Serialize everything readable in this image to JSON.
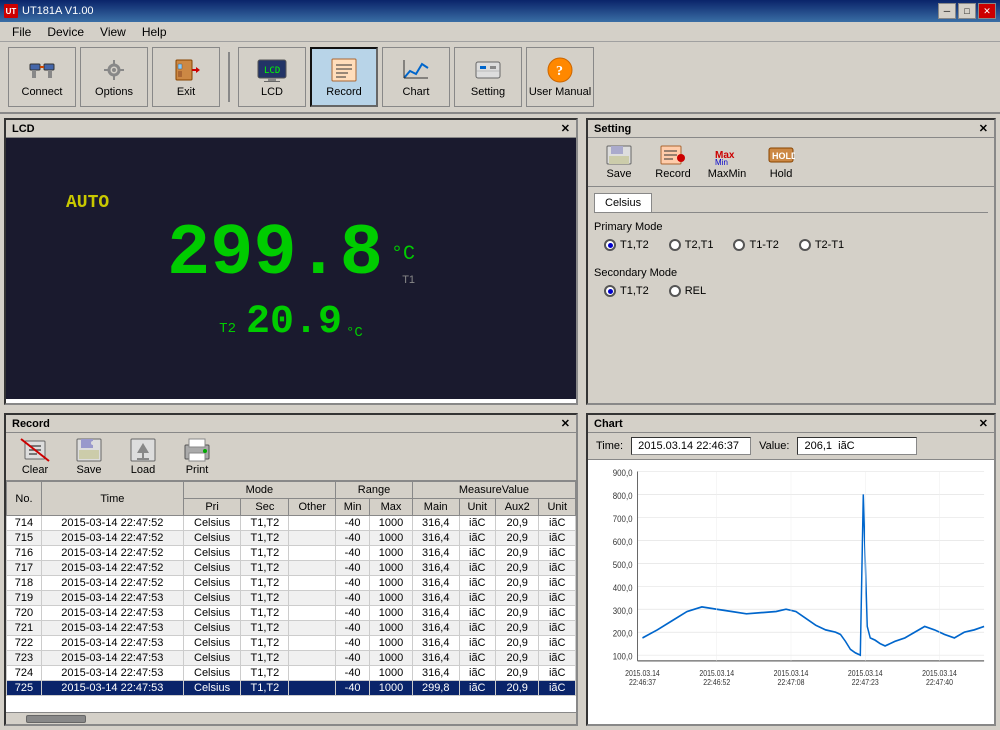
{
  "titleBar": {
    "title": "UT181A V1.00",
    "icon": "UT"
  },
  "menu": {
    "items": [
      "File",
      "Device",
      "View",
      "Help"
    ]
  },
  "toolbar": {
    "buttons": [
      {
        "id": "connect",
        "label": "Connect",
        "icon": "⚡"
      },
      {
        "id": "options",
        "label": "Options",
        "icon": "⚙"
      },
      {
        "id": "exit",
        "label": "Exit",
        "icon": "🚪"
      },
      {
        "id": "lcd",
        "label": "LCD",
        "icon": "📺"
      },
      {
        "id": "record",
        "label": "Record",
        "icon": "📋"
      },
      {
        "id": "chart",
        "label": "Chart",
        "icon": "📈"
      },
      {
        "id": "setting",
        "label": "Setting",
        "icon": "🔧"
      },
      {
        "id": "usermanual",
        "label": "User Manual",
        "icon": "📖"
      }
    ]
  },
  "lcd": {
    "title": "LCD",
    "mode": "AUTO",
    "mainValue": "299.8",
    "mainUnit": "°C",
    "mainLabel": "T1",
    "secondaryLabel": "T2",
    "secondaryValue": "20.9",
    "secondaryUnit": "°C"
  },
  "setting": {
    "title": "Setting",
    "buttons": [
      "Save",
      "Record",
      "MaxMin",
      "Hold"
    ],
    "tabs": [
      "Celsius"
    ],
    "primaryMode": {
      "label": "Primary Mode",
      "options": [
        "T1,T2",
        "T2,T1",
        "T1-T2",
        "T2-T1"
      ],
      "selected": "T1,T2"
    },
    "secondaryMode": {
      "label": "Secondary Mode",
      "options": [
        "T1,T2",
        "REL"
      ],
      "selected": "T1,T2"
    }
  },
  "record": {
    "title": "Record",
    "buttons": [
      "Clear",
      "Save",
      "Load",
      "Print"
    ],
    "columns": {
      "no": "No.",
      "time": "Time",
      "modeGroup": "Mode",
      "pri": "Pri",
      "sec": "Sec",
      "other": "Other",
      "rangeGroup": "Range",
      "min": "Min",
      "max": "Max",
      "measureGroup": "MeasureValue",
      "main": "Main",
      "unit1": "Unit",
      "aux2": "Aux2",
      "unit2": "Unit"
    },
    "rows": [
      {
        "no": "714",
        "time": "2015-03-14 22:47:52",
        "pri": "Celsius",
        "sec": "T1,T2",
        "other": "",
        "min": "-40",
        "max": "1000",
        "main": "316,4",
        "unit1": "iãC",
        "aux2": "20,9",
        "unit2": "iãC"
      },
      {
        "no": "715",
        "time": "2015-03-14 22:47:52",
        "pri": "Celsius",
        "sec": "T1,T2",
        "other": "",
        "min": "-40",
        "max": "1000",
        "main": "316,4",
        "unit1": "iãC",
        "aux2": "20,9",
        "unit2": "iãC"
      },
      {
        "no": "716",
        "time": "2015-03-14 22:47:52",
        "pri": "Celsius",
        "sec": "T1,T2",
        "other": "",
        "min": "-40",
        "max": "1000",
        "main": "316,4",
        "unit1": "iãC",
        "aux2": "20,9",
        "unit2": "iãC"
      },
      {
        "no": "717",
        "time": "2015-03-14 22:47:52",
        "pri": "Celsius",
        "sec": "T1,T2",
        "other": "",
        "min": "-40",
        "max": "1000",
        "main": "316,4",
        "unit1": "iãC",
        "aux2": "20,9",
        "unit2": "iãC"
      },
      {
        "no": "718",
        "time": "2015-03-14 22:47:52",
        "pri": "Celsius",
        "sec": "T1,T2",
        "other": "",
        "min": "-40",
        "max": "1000",
        "main": "316,4",
        "unit1": "iãC",
        "aux2": "20,9",
        "unit2": "iãC"
      },
      {
        "no": "719",
        "time": "2015-03-14 22:47:53",
        "pri": "Celsius",
        "sec": "T1,T2",
        "other": "",
        "min": "-40",
        "max": "1000",
        "main": "316,4",
        "unit1": "iãC",
        "aux2": "20,9",
        "unit2": "iãC"
      },
      {
        "no": "720",
        "time": "2015-03-14 22:47:53",
        "pri": "Celsius",
        "sec": "T1,T2",
        "other": "",
        "min": "-40",
        "max": "1000",
        "main": "316,4",
        "unit1": "iãC",
        "aux2": "20,9",
        "unit2": "iãC"
      },
      {
        "no": "721",
        "time": "2015-03-14 22:47:53",
        "pri": "Celsius",
        "sec": "T1,T2",
        "other": "",
        "min": "-40",
        "max": "1000",
        "main": "316,4",
        "unit1": "iãC",
        "aux2": "20,9",
        "unit2": "iãC"
      },
      {
        "no": "722",
        "time": "2015-03-14 22:47:53",
        "pri": "Celsius",
        "sec": "T1,T2",
        "other": "",
        "min": "-40",
        "max": "1000",
        "main": "316,4",
        "unit1": "iãC",
        "aux2": "20,9",
        "unit2": "iãC"
      },
      {
        "no": "723",
        "time": "2015-03-14 22:47:53",
        "pri": "Celsius",
        "sec": "T1,T2",
        "other": "",
        "min": "-40",
        "max": "1000",
        "main": "316,4",
        "unit1": "iãC",
        "aux2": "20,9",
        "unit2": "iãC"
      },
      {
        "no": "724",
        "time": "2015-03-14 22:47:53",
        "pri": "Celsius",
        "sec": "T1,T2",
        "other": "",
        "min": "-40",
        "max": "1000",
        "main": "316,4",
        "unit1": "iãC",
        "aux2": "20,9",
        "unit2": "iãC"
      },
      {
        "no": "725",
        "time": "2015-03-14 22:47:53",
        "pri": "Celsius",
        "sec": "T1,T2",
        "other": "",
        "min": "-40",
        "max": "1000",
        "main": "299,8",
        "unit1": "iãC",
        "aux2": "20,9",
        "unit2": "iãC",
        "selected": true
      }
    ]
  },
  "chart": {
    "title": "Chart",
    "timeLabel": "Time:",
    "timeValue": "2015.03.14 22:46:37",
    "valueLabel": "Value:",
    "valueValue": "206,1",
    "valueUnit": "iãC",
    "xLabels": [
      "2015.03.14\n22:46:37",
      "2015.03.14\n22:46:52",
      "2015.03.14\n22:47:08",
      "2015.03.14\n22:47:23",
      "2015.03.14\n22:47:40"
    ],
    "yLabels": [
      "100,0",
      "200,0",
      "300,0",
      "400,0",
      "500,0",
      "600,0",
      "700,0",
      "800,0",
      "900,0"
    ]
  }
}
